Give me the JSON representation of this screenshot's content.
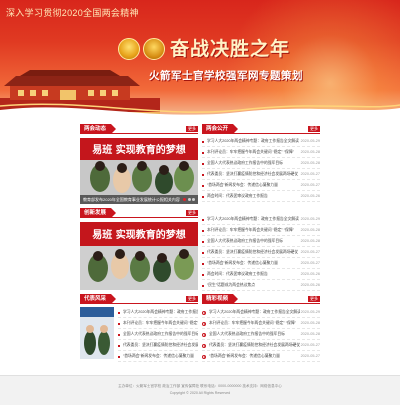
{
  "banner": {
    "slogan": "深入学习贯彻2020全国两会精神",
    "title": "奋战决胜之年",
    "subtitle": "火箭军士官学校强军网专题策划"
  },
  "sections": {
    "news": {
      "label": "两会动态",
      "more": "更多",
      "photo_banner": "易班  实现教育的梦想",
      "caption": "教育部发布2020年全国教育事业发展统计公报相关内容",
      "items": []
    },
    "gongbao": {
      "label": "两会公开",
      "more": "更多",
      "items": [
        {
          "text": "学习人大2020年两会精神专题：政府工作报告全文解读",
          "date": "2020-05-29"
        },
        {
          "text": "本刊评论员：牢牢把握今年两会关键词 “稳定” “保障”",
          "date": "2020-05-28"
        },
        {
          "text": "全国人大代表热议政府工作报告中的强军目标",
          "date": "2020-05-28"
        },
        {
          "text": "代表委员：坚决打赢疫情防控和经济社会发展两场硬仗",
          "date": "2020-05-27"
        },
        {
          "text": "“首场两会”新闻发布会：传递信心凝聚力量",
          "date": "2020-05-27"
        },
        {
          "text": "两会时间：代表团审议政府工作报告",
          "date": "2020-05-26"
        },
        {
          "text": "“民生”话题成为两会热议焦点",
          "date": "2020-05-26"
        }
      ]
    },
    "sijian": {
      "label": "创新发展",
      "more": "更多",
      "photo_banner": "易班  实现教育的梦想",
      "caption": "教育部发布2020年全国教育事业发展统计公报相关内容",
      "items": [
        {
          "text": "学习人大2020年两会精神专题：政府工作报告全文解读",
          "date": "2020-05-29"
        },
        {
          "text": "本刊评论员：牢牢把握今年两会关键词 “稳定” “保障”",
          "date": "2020-05-28"
        },
        {
          "text": "全国人大代表热议政府工作报告中的强军目标",
          "date": "2020-05-28"
        },
        {
          "text": "代表委员：坚决打赢疫情防控和经济社会发展两场硬仗",
          "date": "2020-05-27"
        },
        {
          "text": "“首场两会”新闻发布会：传递信心凝聚力量",
          "date": "2020-05-27"
        },
        {
          "text": "两会时间：代表团审议政府工作报告",
          "date": "2020-05-26"
        },
        {
          "text": "“民生”话题成为两会热议焦点",
          "date": "2020-05-26"
        }
      ]
    },
    "daibiao": {
      "label": "代表风采",
      "more": "更多",
      "items": [
        {
          "text": "学习人大2020年两会精神专题：政府工作报告全文解读"
        },
        {
          "text": "本刊评论员：牢牢把握今年两会关键词 “稳定” “保障”"
        },
        {
          "text": "全国人大代表热议政府工作报告中的强军目标"
        },
        {
          "text": "代表委员：坚决打赢疫情防控和经济社会发展两场硬仗"
        },
        {
          "text": "“首场两会”新闻发布会：传递信心凝聚力量"
        }
      ]
    },
    "video": {
      "label": "精彩视频",
      "more": "更多",
      "items": [
        {
          "text": "学习人大2020年两会精神专题：政府工作报告全文解读",
          "date": "2020-05-29"
        },
        {
          "text": "本刊评论员：牢牢把握今年两会关键词 “稳定” “保障”",
          "date": "2020-05-28"
        },
        {
          "text": "全国人大代表热议政府工作报告中的强军目标",
          "date": "2020-05-28"
        },
        {
          "text": "代表委员：坚决打赢疫情防控和经济社会发展两场硬仗",
          "date": "2020-05-27"
        },
        {
          "text": "“首场两会”新闻发布会：传递信心凝聚力量",
          "date": "2020-05-27"
        }
      ]
    }
  },
  "footer": {
    "line1": "主办单位：火箭军士官学校 政治工作部 宣传保障处 联系电话：0000-0000000 技术支持：网络信息中心",
    "line2": "Copyright © 2020 All Rights Reserved"
  },
  "colors": {
    "brand_red": "#c9151e",
    "banner_gold": "#fff3c8"
  }
}
